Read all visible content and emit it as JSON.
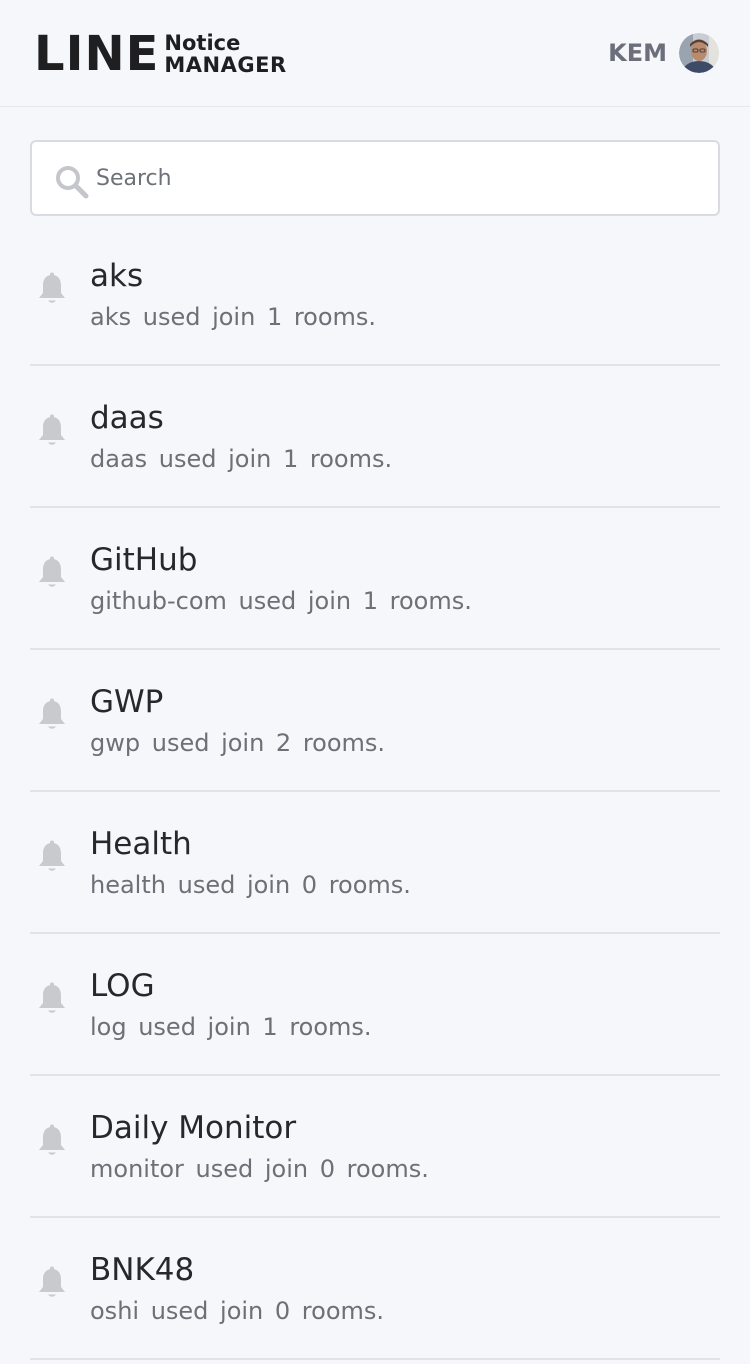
{
  "header": {
    "brand_line": "LINE",
    "brand_notice": "Notice",
    "brand_manager": "MANAGER",
    "user_name": "KEM",
    "avatar_icon": "user-avatar"
  },
  "search": {
    "placeholder": "Search",
    "value": "",
    "icon": "search-icon"
  },
  "items": [
    {
      "title": "aks",
      "description": "aks used join 1 rooms.",
      "icon": "bell-icon"
    },
    {
      "title": "daas",
      "description": "daas used join 1 rooms.",
      "icon": "bell-icon"
    },
    {
      "title": "GitHub",
      "description": "github-com used join 1 rooms.",
      "icon": "bell-icon"
    },
    {
      "title": "GWP",
      "description": "gwp used join 2 rooms.",
      "icon": "bell-icon"
    },
    {
      "title": "Health",
      "description": "health used join 0 rooms.",
      "icon": "bell-icon"
    },
    {
      "title": "LOG",
      "description": "log used join 1 rooms.",
      "icon": "bell-icon"
    },
    {
      "title": "Daily Monitor",
      "description": "monitor used join 0 rooms.",
      "icon": "bell-icon"
    },
    {
      "title": "BNK48",
      "description": "oshi used join 0 rooms.",
      "icon": "bell-icon"
    }
  ],
  "colors": {
    "background": "#f6f7fb",
    "text_primary": "#26282b",
    "text_secondary": "#6c7077",
    "bell": "#c9cacd",
    "divider": "#e2e3e7"
  }
}
